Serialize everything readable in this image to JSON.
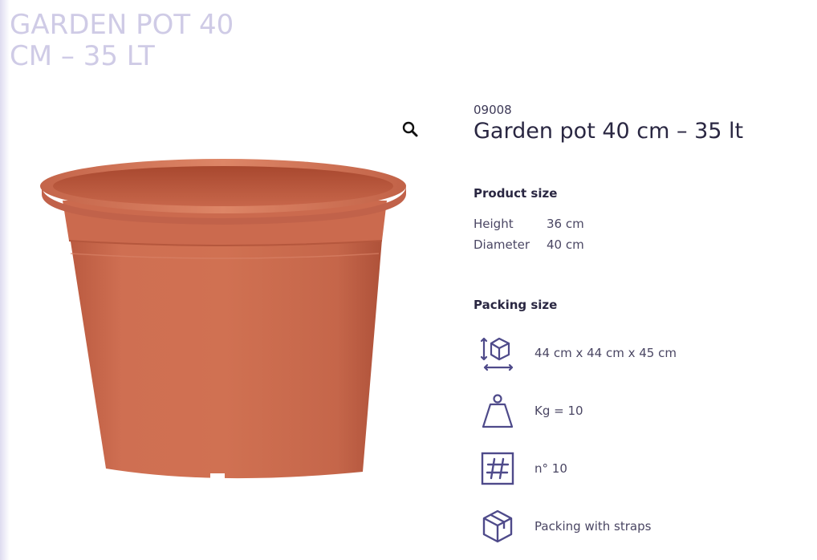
{
  "page_title": {
    "line1": "GARDEN POT 40",
    "line2": "CM – 35 LT"
  },
  "product": {
    "sku": "09008",
    "name": "Garden pot 40 cm – 35 lt"
  },
  "product_size": {
    "label": "Product size",
    "rows": [
      {
        "key": "Height",
        "value": "36 cm"
      },
      {
        "key": "Diameter",
        "value": "40 cm"
      }
    ]
  },
  "packing_size": {
    "label": "Packing size",
    "items": [
      {
        "icon": "box-dimensions-icon",
        "text": "44 cm x 44 cm x 45 cm"
      },
      {
        "icon": "weight-icon",
        "text": "Kg = 10"
      },
      {
        "icon": "hash-icon",
        "text": "n° 10"
      },
      {
        "icon": "package-icon",
        "text": "Packing with straps"
      }
    ]
  },
  "icons": {
    "zoom": "magnifier-icon"
  },
  "colors": {
    "title": "#cfcbe6",
    "icon": "#4e4a8a",
    "pot": "#c9674b",
    "text": "#2a2742"
  }
}
